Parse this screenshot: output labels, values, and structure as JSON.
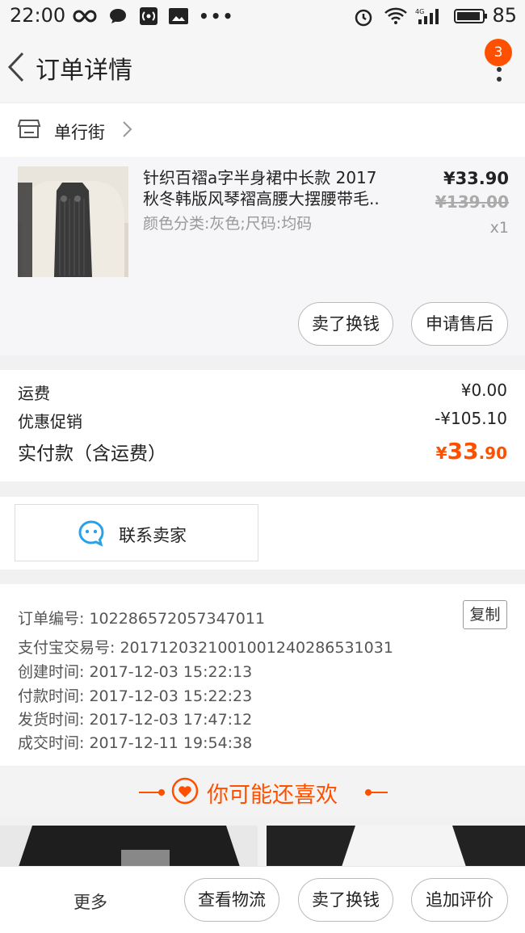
{
  "status_bar": {
    "time": "22:00",
    "battery": "85"
  },
  "nav": {
    "title": "订单详情",
    "badge": "3"
  },
  "shop": {
    "name": "单行街"
  },
  "item": {
    "title_line1": "针织百褶a字半身裙中长款 2017",
    "title_line2": "秋冬韩版风琴褶高腰大摆腰带毛..",
    "sku": "颜色分类:灰色;尺码:均码",
    "price": "¥33.90",
    "original_price": "¥139.00",
    "quantity": "x1",
    "actions": [
      "卖了换钱",
      "申请售后"
    ]
  },
  "fees": {
    "shipping_label": "运费",
    "shipping_value": "¥0.00",
    "discount_label": "优惠促销",
    "discount_value": "-¥105.10",
    "total_label": "实付款（含运费）",
    "total_currency": "¥",
    "total_int": "33",
    "total_dec": ".90"
  },
  "contact": {
    "label": "联系卖家"
  },
  "order_info": {
    "order_no": "订单编号: 1022865720573470​11",
    "copy_label": "复制",
    "alipay_no": "支付宝交易号: 2017120321001001240286531031",
    "created": "创建时间: 2017-12-03 15:22:13",
    "paid": "付款时间: 2017-12-03 15:22:23",
    "shipped": "发货时间: 2017-12-03 17:47:12",
    "completed": "成交时间: 2017-12-11 19:54:38"
  },
  "recommend": {
    "title": "你可能还喜欢"
  },
  "bottom_bar": {
    "more": "更多",
    "buttons": [
      "查看物流",
      "卖了换钱",
      "追加评价"
    ]
  },
  "colors": {
    "accent": "#ff5000",
    "link_blue": "#29a1e6"
  }
}
